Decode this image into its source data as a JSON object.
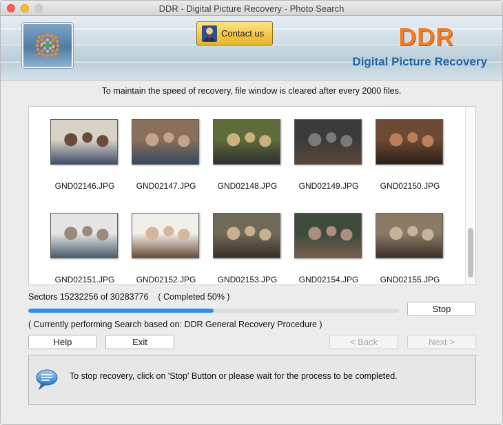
{
  "window": {
    "title": "DDR - Digital Picture Recovery - Photo Search"
  },
  "banner": {
    "contact_label": "Contact us",
    "brand_name": "DDR",
    "brand_subtitle": "Digital Picture Recovery"
  },
  "notice": "To maintain the speed of recovery, file window is cleared after every 2000 files.",
  "files": [
    {
      "name": "GND02146.JPG",
      "colors": [
        "#d9d2c6",
        "#6b4a38",
        "#3e4f6b"
      ]
    },
    {
      "name": "GND02147.JPG",
      "colors": [
        "#8a6f5a",
        "#c4a48a",
        "#34495e"
      ]
    },
    {
      "name": "GND02148.JPG",
      "colors": [
        "#5e6b3a",
        "#c9b27c",
        "#2e2e2e"
      ]
    },
    {
      "name": "GND02149.JPG",
      "colors": [
        "#3b3b3b",
        "#7a7a7a",
        "#5a4637"
      ]
    },
    {
      "name": "GND02150.JPG",
      "colors": [
        "#6d4a33",
        "#b9805a",
        "#2c1f17"
      ]
    },
    {
      "name": "GND02151.JPG",
      "colors": [
        "#e5e5e5",
        "#9b8a78",
        "#4a5a6a"
      ]
    },
    {
      "name": "GND02152.JPG",
      "colors": [
        "#f1efe9",
        "#d4b69a",
        "#6a4d3a"
      ]
    },
    {
      "name": "GND02153.JPG",
      "colors": [
        "#6f6a58",
        "#c9b08f",
        "#3c2f25"
      ]
    },
    {
      "name": "GND02154.JPG",
      "colors": [
        "#3e4a3c",
        "#a98f7c",
        "#7a5f4c"
      ]
    },
    {
      "name": "GND02155.JPG",
      "colors": [
        "#8a7a66",
        "#c7b39a",
        "#3d3028"
      ]
    }
  ],
  "progress": {
    "sectors_text": "Sectors 15232256 of 30283776",
    "completed_text": "( Completed 50% )",
    "percent": 50
  },
  "current_text": "( Currently performing Search based on: DDR General Recovery Procedure )",
  "buttons": {
    "stop": "Stop",
    "help": "Help",
    "exit": "Exit",
    "back": "< Back",
    "next": "Next >"
  },
  "status_message": "To stop recovery, click on 'Stop' Button or please wait for the process to be completed.",
  "colors": {
    "accent": "#2d8cf0",
    "brand_orange": "#f07c27",
    "brand_blue": "#1f63a8"
  }
}
